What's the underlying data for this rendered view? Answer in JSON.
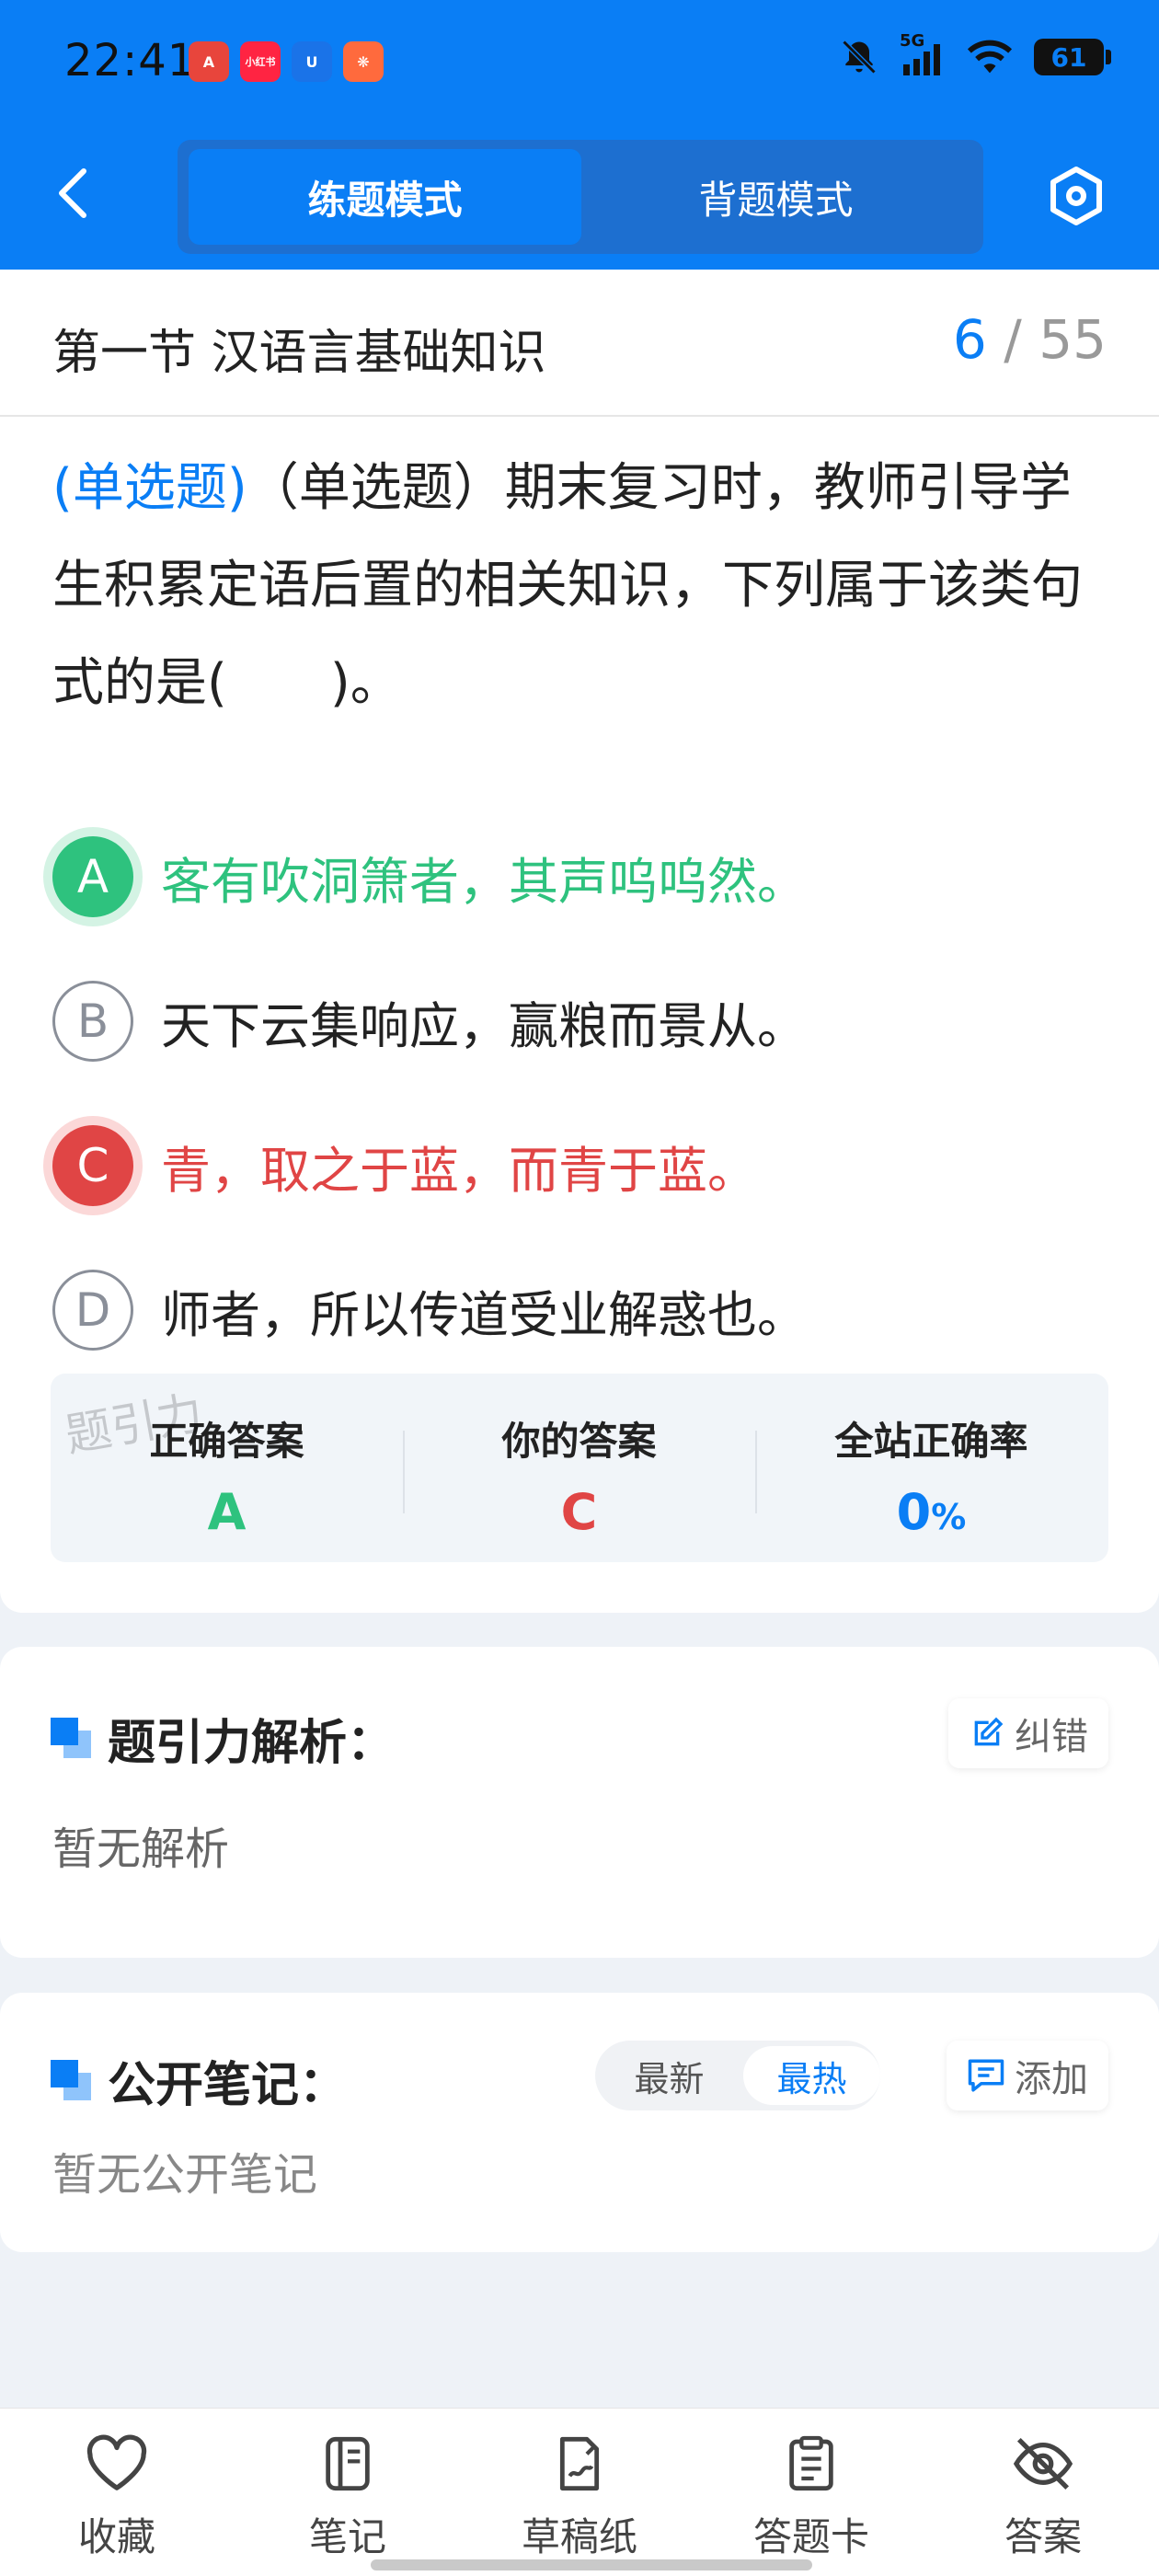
{
  "status_bar": {
    "time": "22:41",
    "battery": "61",
    "network": "5G",
    "icons": [
      "bell-off-icon",
      "signal-icon",
      "wifi-icon",
      "battery-icon"
    ],
    "app_icons": [
      {
        "name": "app-a",
        "glyph": "A",
        "color": "#e8453c"
      },
      {
        "name": "xiaohongshu",
        "glyph": "小红书",
        "color": "#ff2442"
      },
      {
        "name": "app-u",
        "glyph": "U",
        "color": "#1a73e8"
      },
      {
        "name": "app-food",
        "glyph": "❋",
        "color": "#ff6a3d"
      }
    ]
  },
  "header": {
    "mode_active": "练题模式",
    "mode_inactive": "背题模式",
    "brand_color": "#0a7ef5"
  },
  "section": {
    "title": "第一节 汉语言基础知识",
    "current": "6",
    "separator": "/",
    "total": "55"
  },
  "question": {
    "type_label": "(单选题)",
    "text": "（单选题）期末复习时，教师引导学生积累定语后置的相关知识，下列属于该类句式的是(　　)。"
  },
  "options": [
    {
      "letter": "A",
      "text": "客有吹洞箫者，其声呜呜然。",
      "state": "correct"
    },
    {
      "letter": "B",
      "text": "天下云集响应，赢粮而景从。",
      "state": "normal"
    },
    {
      "letter": "C",
      "text": "青，取之于蓝，而青于蓝。",
      "state": "wrong"
    },
    {
      "letter": "D",
      "text": "师者，所以传道受业解惑也。",
      "state": "normal"
    }
  ],
  "result": {
    "correct_label": "正确答案",
    "correct_value": "A",
    "yours_label": "你的答案",
    "yours_value": "C",
    "rate_label": "全站正确率",
    "rate_value": "0",
    "rate_unit": "%",
    "watermark": "题引力",
    "colors": {
      "correct": "#2ec27e",
      "wrong": "#e04545",
      "rate": "#0a7ef5"
    }
  },
  "analysis": {
    "title": "题引力解析：",
    "correction_button": "纠错",
    "empty": "暂无解析"
  },
  "notes": {
    "title": "公开笔记：",
    "sort_newest": "最新",
    "sort_hottest": "最热",
    "add_button": "添加",
    "empty": "暂无公开笔记"
  },
  "bottom_nav": [
    {
      "label": "收藏",
      "icon": "heart-icon"
    },
    {
      "label": "笔记",
      "icon": "notebook-icon"
    },
    {
      "label": "草稿纸",
      "icon": "draft-icon"
    },
    {
      "label": "答题卡",
      "icon": "answer-sheet-icon"
    },
    {
      "label": "答案",
      "icon": "eye-off-icon"
    }
  ]
}
